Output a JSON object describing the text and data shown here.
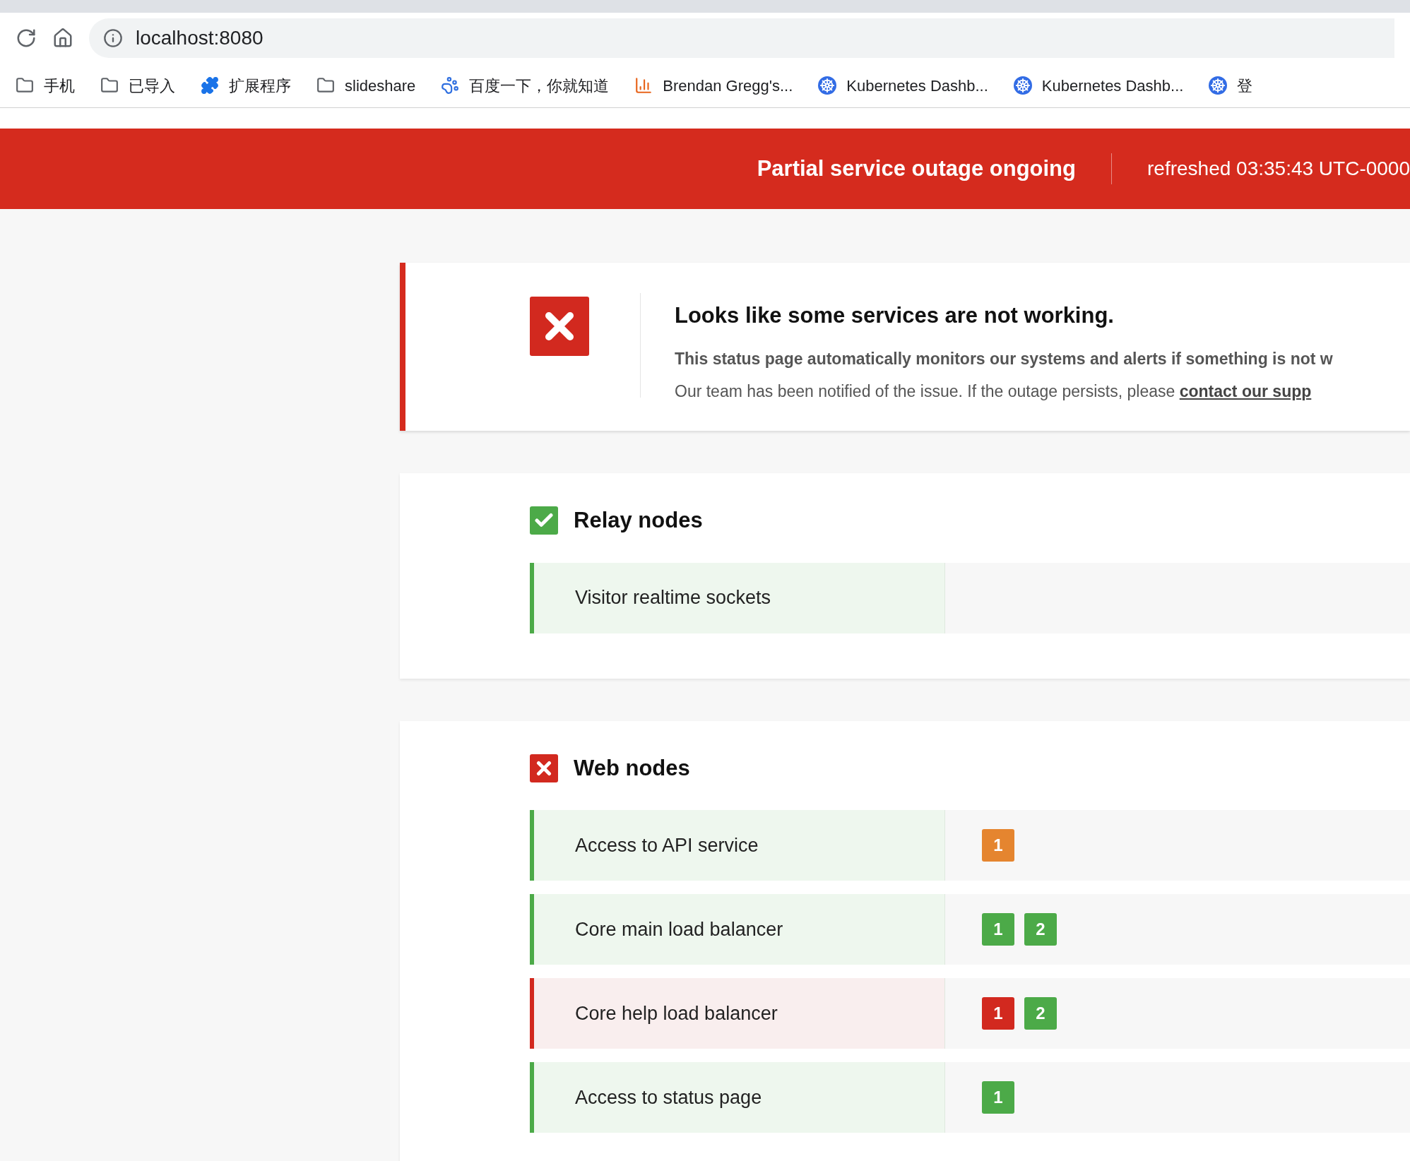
{
  "browser": {
    "address": "localhost:8080",
    "bookmarks": [
      {
        "kind": "folder",
        "label": "手机"
      },
      {
        "kind": "folder",
        "label": "已导入"
      },
      {
        "kind": "extension",
        "label": "扩展程序"
      },
      {
        "kind": "folder",
        "label": "slideshare"
      },
      {
        "kind": "paw",
        "label": "百度一下，你就知道"
      },
      {
        "kind": "chart",
        "label": "Brendan Gregg's..."
      },
      {
        "kind": "wheel",
        "label": "Kubernetes Dashb..."
      },
      {
        "kind": "wheel",
        "label": "Kubernetes Dashb..."
      },
      {
        "kind": "wheel",
        "label": "登"
      }
    ]
  },
  "banner": {
    "status": "Partial service outage ongoing",
    "refreshed": "refreshed 03:35:43 UTC-0000"
  },
  "alert": {
    "title": "Looks like some services are not working.",
    "line_1": "This status page automatically monitors our systems and alerts if something is not w",
    "line_2": "Our team has been notified of the issue. If the outage persists, please ",
    "link": "contact our supp"
  },
  "groups": [
    {
      "name": "Relay nodes",
      "kind": "ok",
      "services": [
        {
          "name": "Visitor realtime sockets",
          "kind": "ok"
        }
      ]
    },
    {
      "name": "Web nodes",
      "kind": "down",
      "services": [
        {
          "name": "Access to API service",
          "kind": "ok",
          "nodes": [
            {
              "label": "1",
              "color": "#e5852f"
            }
          ]
        },
        {
          "name": "Core main load balancer",
          "kind": "ok",
          "nodes": [
            {
              "label": "1",
              "color": "#4caa48"
            },
            {
              "label": "2",
              "color": "#4caa48"
            }
          ]
        },
        {
          "name": "Core help load balancer",
          "kind": "down",
          "nodes": [
            {
              "label": "1",
              "color": "#d2291f"
            },
            {
              "label": "2",
              "color": "#4caa48"
            }
          ]
        },
        {
          "name": "Access to status page",
          "kind": "ok",
          "nodes": [
            {
              "label": "1",
              "color": "#4caa48"
            }
          ]
        }
      ]
    }
  ]
}
